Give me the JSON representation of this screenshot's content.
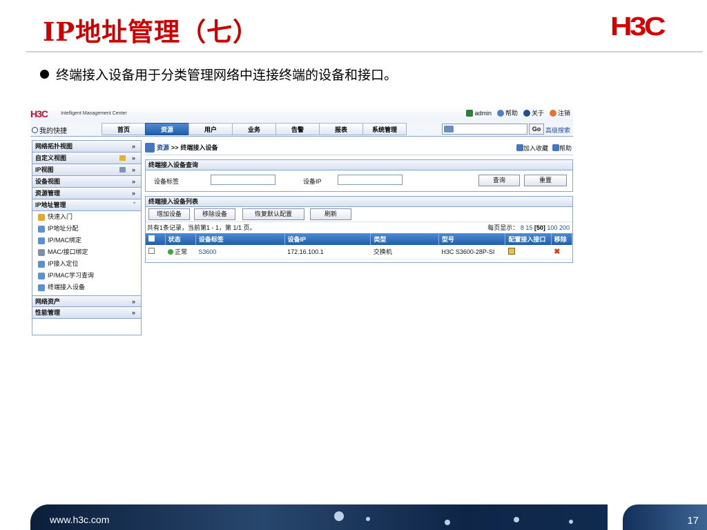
{
  "slide": {
    "title": "IP地址管理（七）",
    "logo": "H3C",
    "bullet": "终端接入设备用于分类管理网络中连接终端的设备和接口。",
    "footer_url": "www.h3c.com",
    "page_number": "17"
  },
  "app": {
    "logo": "H3C",
    "product": "Intelligent Management Center",
    "top_links": {
      "user": "admin",
      "help": "帮助",
      "about": "关于",
      "logout": "注销"
    },
    "shortcut": "我的快捷",
    "tabs": [
      "首页",
      "资源",
      "用户",
      "业务",
      "告警",
      "报表",
      "系统管理"
    ],
    "active_tab": "资源",
    "search": {
      "go": "Go",
      "advanced": "高级搜索"
    },
    "sidebar": {
      "sections": [
        "网络拓扑视图",
        "自定义视图",
        "IP视图",
        "设备视图",
        "资源管理",
        "IP地址管理"
      ],
      "items": [
        "快速入门",
        "IP地址分配",
        "IP/MAC绑定",
        "MAC/接口绑定",
        "IP接入定位",
        "IP/MAC学习查询",
        "终端接入设备"
      ],
      "bottom_sections": [
        "网络资产",
        "性能管理"
      ]
    },
    "breadcrumb": {
      "root": "资源",
      "sep": ">>",
      "current": "终端接入设备",
      "fav": "加入收藏",
      "help": "帮助"
    },
    "query": {
      "title": "终端接入设备查询",
      "label_tag": "设备标签",
      "label_ip": "设备IP",
      "btn_query": "查询",
      "btn_reset": "重置"
    },
    "list": {
      "title": "终端接入设备列表",
      "buttons": [
        "增加设备",
        "移除设备",
        "恢复默认配置",
        "刷新"
      ],
      "summary": "共有1条记录，当前第1 - 1，第 1/1 页。",
      "per_page_label": "每页显示：",
      "per_page": [
        "8",
        "15",
        "[50]",
        "100",
        "200"
      ],
      "columns": [
        "状态",
        "设备标签",
        "设备IP",
        "类型",
        "型号",
        "配置接入接口",
        "移除"
      ],
      "rows": [
        {
          "status": "正常",
          "tag": "S3600",
          "ip": "172.16.100.1",
          "type": "交换机",
          "model": "H3C S3600-28P-SI"
        }
      ]
    }
  }
}
